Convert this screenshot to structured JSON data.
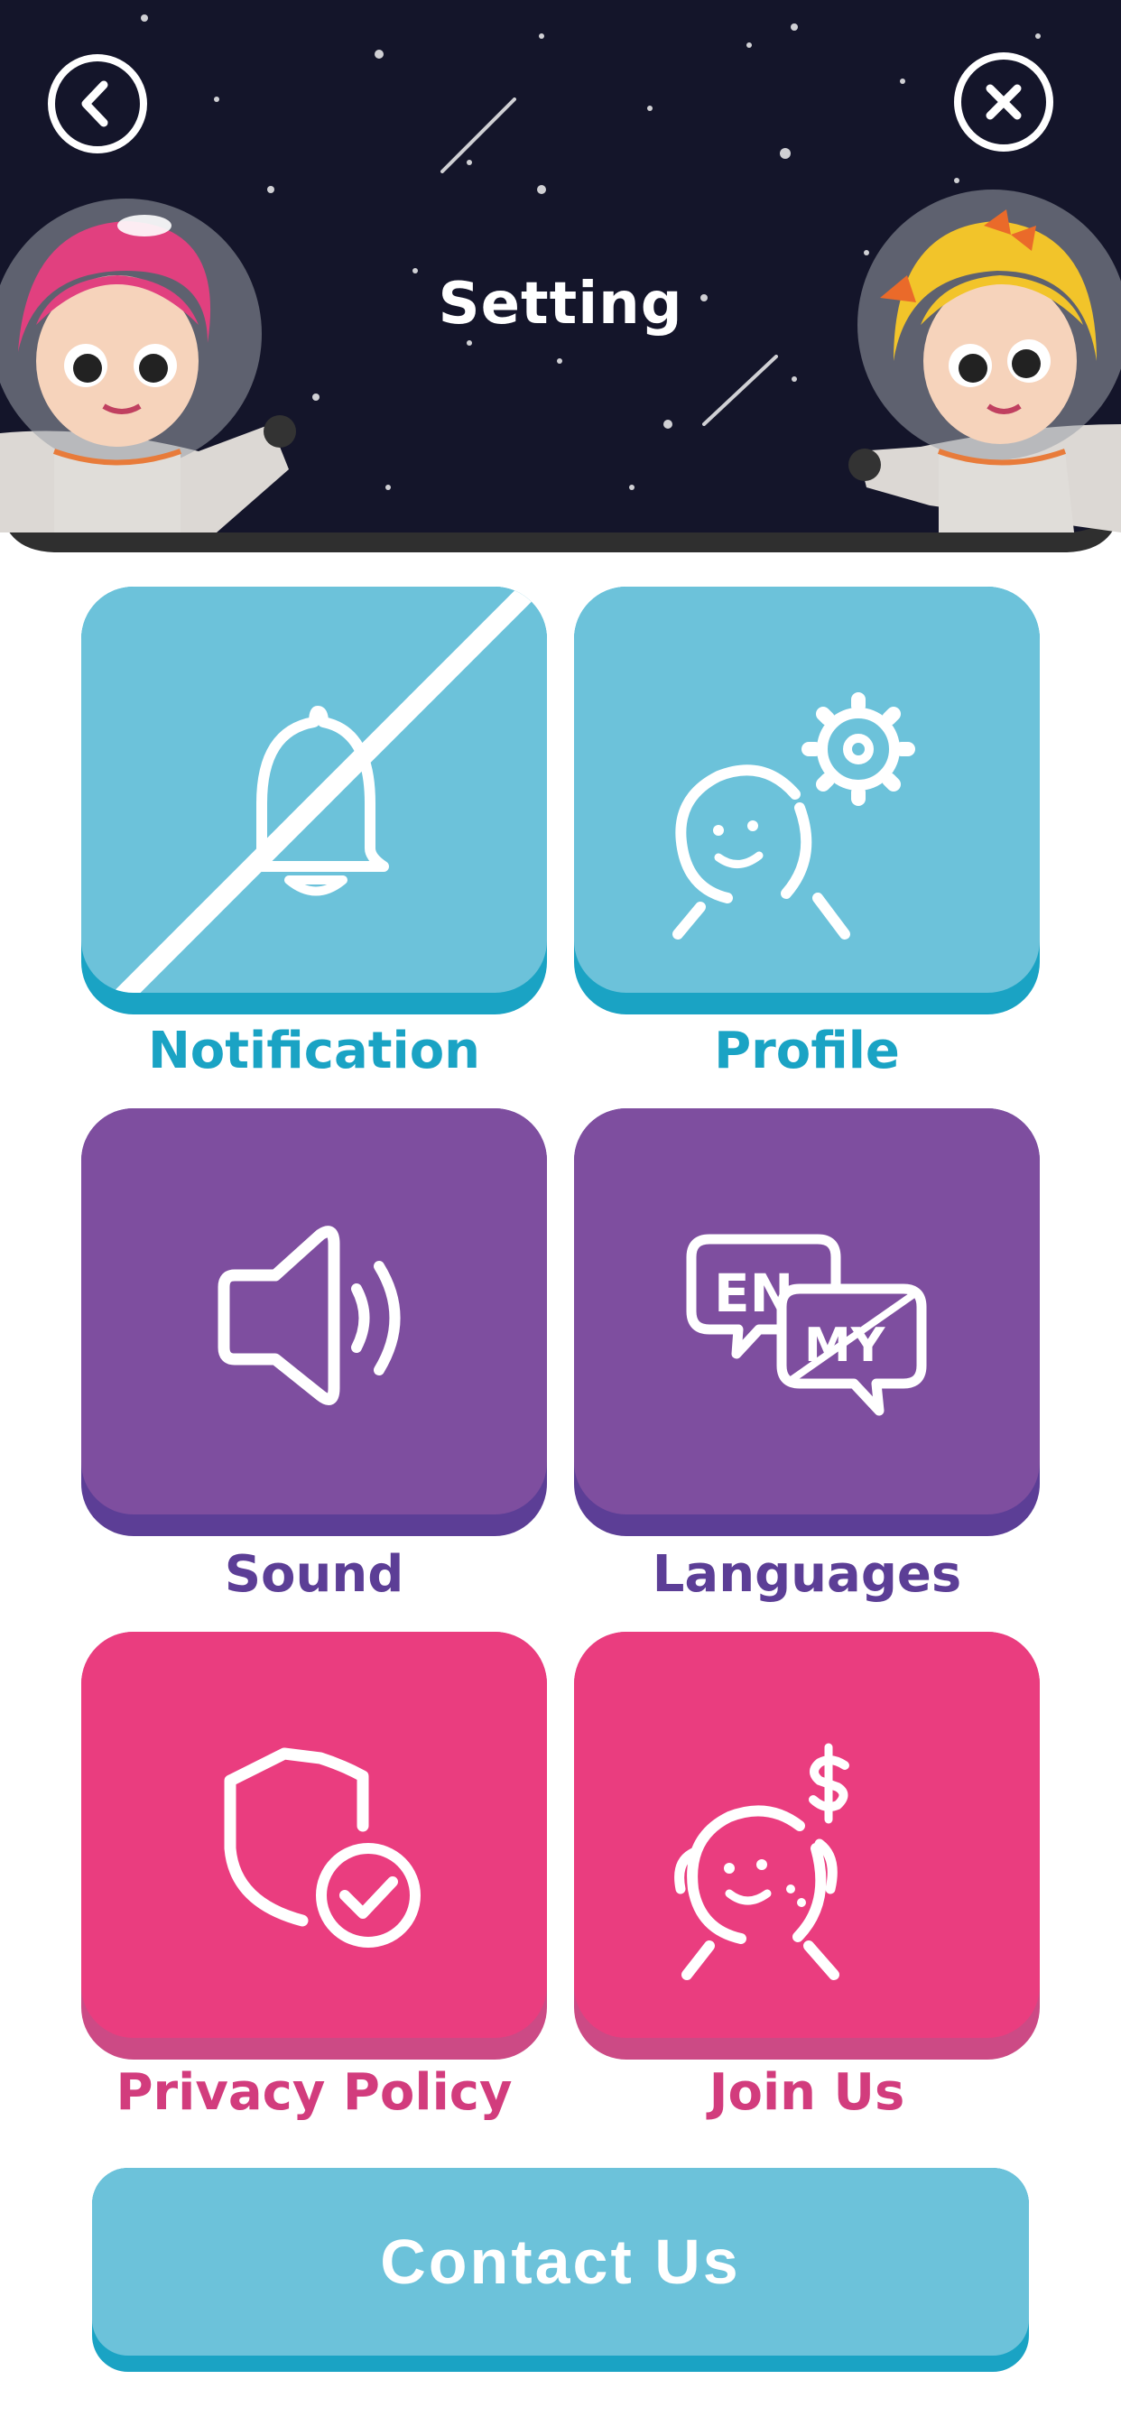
{
  "header": {
    "title": "Setting",
    "back_icon": "chevron-left-icon",
    "close_icon": "close-icon"
  },
  "colors": {
    "sky": "#14152a",
    "blue": "#6cc2da",
    "blue_edge": "#1aa3c4",
    "blue_text": "#1aa3c4",
    "purple": "#7e4e9f",
    "purple_edge": "#5c3e96",
    "purple_text": "#5c3e96",
    "pink": "#ea3d7f",
    "pink_edge": "#cc4a85",
    "pink_text": "#d23c7d"
  },
  "settings": {
    "notification": {
      "label": "Notification",
      "icon": "bell-off-icon"
    },
    "profile": {
      "label": "Profile",
      "icon": "profile-gear-icon"
    },
    "sound": {
      "label": "Sound",
      "icon": "speaker-icon"
    },
    "languages": {
      "label": "Languages",
      "icon": "language-bubbles-icon",
      "icon_text_1": "EN",
      "icon_text_2": "MY"
    },
    "privacy": {
      "label": "Privacy Policy",
      "icon": "shield-check-icon"
    },
    "join": {
      "label": "Join Us",
      "icon": "money-face-icon"
    }
  },
  "contact": {
    "label": "Contact Us"
  }
}
